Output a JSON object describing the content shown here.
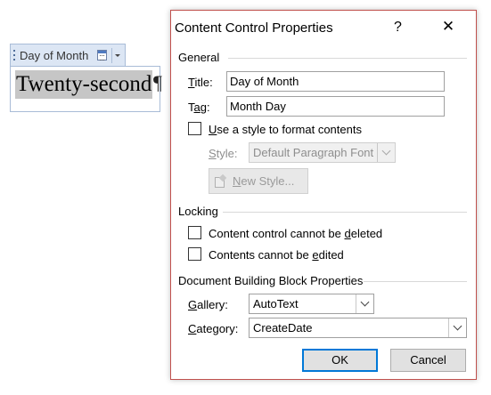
{
  "document": {
    "content_control_title": "Day of Month",
    "content_control_value": "Twenty-second",
    "paragraph_mark": "¶"
  },
  "dialog": {
    "title": "Content Control Properties",
    "help_label": "?",
    "close_label": "✕",
    "general": {
      "heading": "General",
      "title_label_u": "T",
      "title_label_rest": "itle:",
      "title_value": "Day of Month",
      "tag_label_a": "T",
      "tag_label_u": "a",
      "tag_label_rest": "g:",
      "tag_value": "Month Day",
      "use_style_u": "U",
      "use_style_rest": "se a style to format contents",
      "use_style_checked": false,
      "style_label_u": "S",
      "style_label_rest": "tyle:",
      "style_value": "Default Paragraph Font",
      "new_style_u": "N",
      "new_style_rest": "ew Style..."
    },
    "locking": {
      "heading": "Locking",
      "cannot_delete_a": "Content control cannot be ",
      "cannot_delete_u": "d",
      "cannot_delete_b": "eleted",
      "cannot_delete_checked": false,
      "cannot_edit_a": "Contents cannot be ",
      "cannot_edit_u": "e",
      "cannot_edit_b": "dited",
      "cannot_edit_checked": false
    },
    "building_block": {
      "heading": "Document Building Block Properties",
      "gallery_u": "G",
      "gallery_rest": "allery:",
      "gallery_value": "AutoText",
      "category_u": "C",
      "category_rest": "ategory:",
      "category_value": "CreateDate"
    },
    "ok_label": "OK",
    "cancel_label": "Cancel"
  },
  "colors": {
    "dialog_border": "#c0504d",
    "default_button_border": "#0078d7",
    "content_control_tab": "#dce6f4",
    "selection_gray": "#c6c6c6"
  },
  "icons": [
    "content-control-grip-icon",
    "calendar-icon",
    "dropdown-arrow-icon",
    "help-icon",
    "close-icon",
    "chevron-down-icon",
    "new-style-icon"
  ]
}
